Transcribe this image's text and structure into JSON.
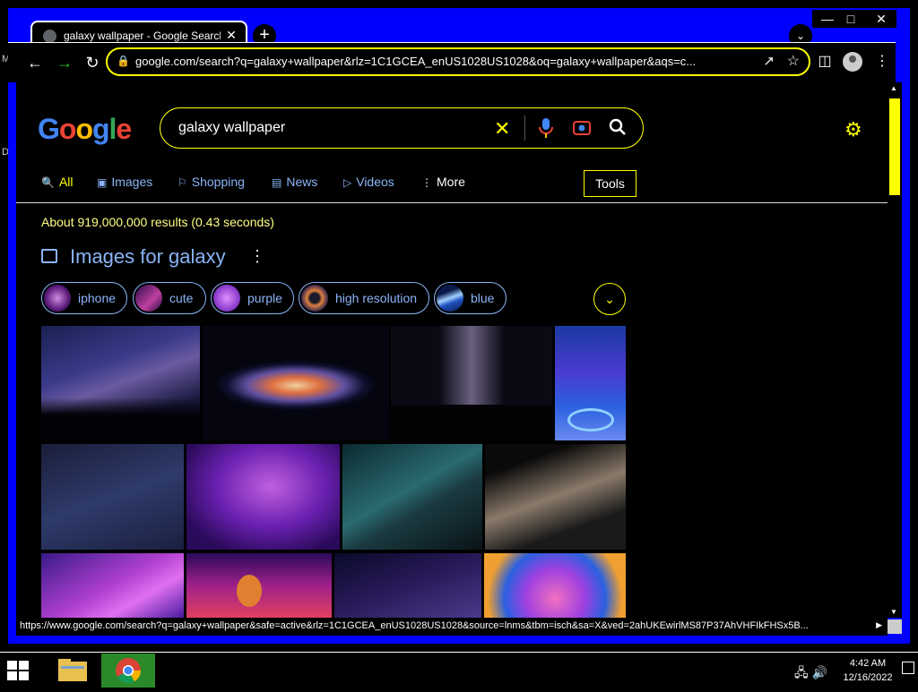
{
  "desktop": {
    "left_labels": [
      "M",
      "D"
    ]
  },
  "browser": {
    "tab_title": "galaxy wallpaper - Google Search",
    "new_tab_label": "+",
    "url": "google.com/search?q=galaxy+wallpaper&rlz=1C1GCEA_enUS1028US1028&oq=galaxy+wallpaper&aqs=c...",
    "status_url": "https://www.google.com/search?q=galaxy+wallpaper&safe=active&rlz=1C1GCEA_enUS1028US1028&source=lnms&tbm=isch&sa=X&ved=2ahUKEwirlMS87P37AhVHFIkFHSx5B..."
  },
  "google": {
    "query": "galaxy wallpaper",
    "tabs": [
      {
        "label": "All",
        "icon": "search-icon"
      },
      {
        "label": "Images",
        "icon": "image-icon"
      },
      {
        "label": "Shopping",
        "icon": "tag-icon"
      },
      {
        "label": "News",
        "icon": "news-icon"
      },
      {
        "label": "Videos",
        "icon": "video-icon"
      },
      {
        "label": "More",
        "icon": "more-vertical-icon"
      }
    ],
    "tools_label": "Tools",
    "result_stats": "About 919,000,000 results (0.43 seconds)",
    "images_heading": "Images for galaxy",
    "chips": [
      {
        "label": "iphone"
      },
      {
        "label": "cute"
      },
      {
        "label": "purple"
      },
      {
        "label": "high resolution"
      },
      {
        "label": "blue"
      }
    ]
  },
  "colors": {
    "accent": "#ffff00",
    "link": "#8ab4f8",
    "window_frame": "#0000ff"
  },
  "taskbar": {
    "time": "4:42 AM",
    "date": "12/16/2022"
  }
}
